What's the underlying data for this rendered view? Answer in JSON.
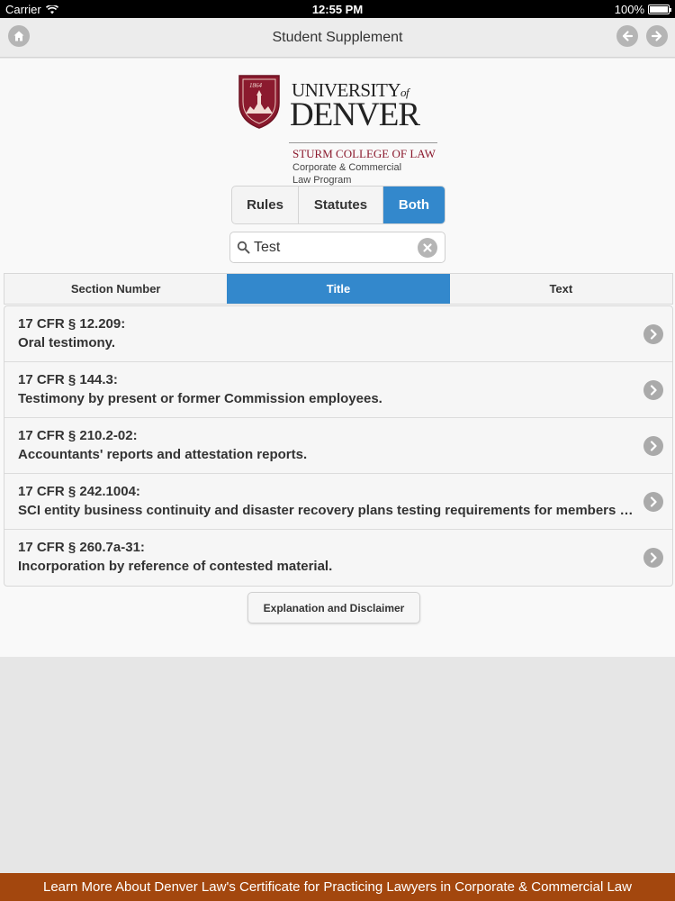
{
  "status_bar": {
    "carrier": "Carrier",
    "time": "12:55 PM",
    "battery": "100%",
    "battery_level": 1.0
  },
  "nav": {
    "title": "Student Supplement",
    "home_icon": "home-icon",
    "back_icon": "arrow-left-icon",
    "forward_icon": "arrow-right-icon"
  },
  "logo": {
    "university": "UNIVERSITY",
    "of": "of",
    "denver": "DENVER",
    "seal_year": "1864",
    "college": "STURM COLLEGE OF LAW",
    "program_line1": "Corporate & Commercial",
    "program_line2": "Law Program"
  },
  "segments": [
    {
      "label": "Rules",
      "active": false
    },
    {
      "label": "Statutes",
      "active": false
    },
    {
      "label": "Both",
      "active": true
    }
  ],
  "search": {
    "value": "Test",
    "placeholder": ""
  },
  "tabs": [
    {
      "label": "Section Number",
      "active": false
    },
    {
      "label": "Title",
      "active": true
    },
    {
      "label": "Text",
      "active": false
    }
  ],
  "results": [
    {
      "section": "17 CFR § 12.209:",
      "title": "Oral testimony."
    },
    {
      "section": "17 CFR § 144.3:",
      "title": "Testimony by present or former Commission employees."
    },
    {
      "section": "17 CFR § 210.2-02:",
      "title": "Accountants' reports and attestation reports."
    },
    {
      "section": "17 CFR § 242.1004:",
      "title": "SCI entity business continuity and disaster recovery plans testing requirements for members or participants."
    },
    {
      "section": "17 CFR § 260.7a-31:",
      "title": "Incorporation by reference of contested material."
    }
  ],
  "disclaimer_label": "Explanation and Disclaimer",
  "banner_text": "Learn More About Denver Law's Certificate for Practicing Lawyers in Corporate & Commercial Law",
  "colors": {
    "accent": "#3388cc",
    "brand": "#8b1a2e",
    "banner": "#a3470e"
  }
}
